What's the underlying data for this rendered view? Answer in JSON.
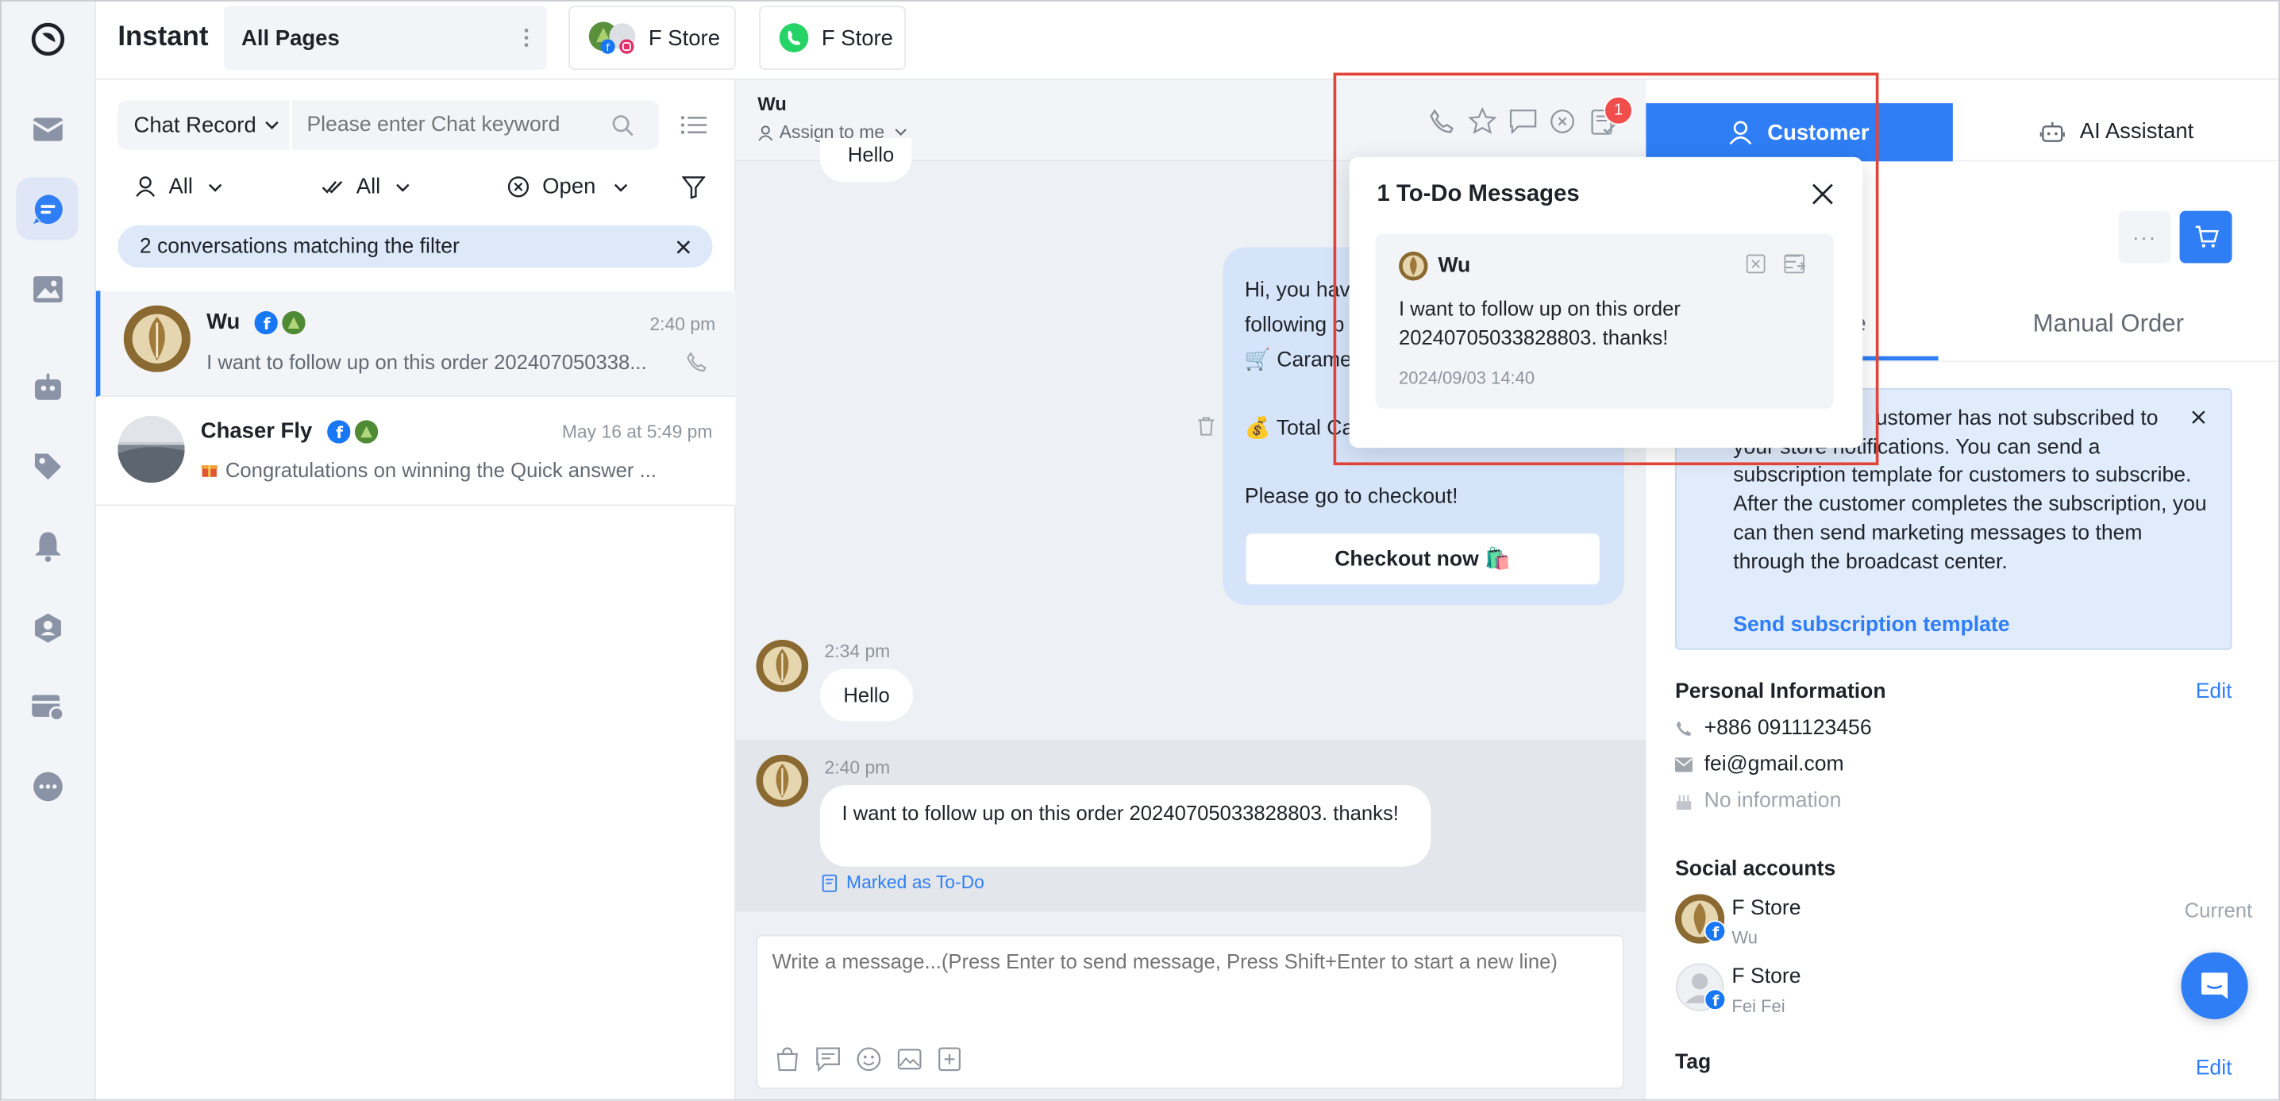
{
  "app": {
    "title": "Instant",
    "pages_label": "All Pages"
  },
  "top_tabs": [
    {
      "label": "F Store",
      "icon": "facebook-instagram-icon"
    },
    {
      "label": "F Store",
      "icon": "whatsapp-icon"
    }
  ],
  "filters": {
    "search_type": "Chat Record",
    "search_placeholder": "Please enter Chat keyword",
    "agent": "All",
    "read": "All",
    "status": "Open",
    "match_text": "2 conversations matching the filter"
  },
  "conversations": [
    {
      "name": "Wu",
      "time": "2:40 pm",
      "preview": "I want to follow up on this order 202407050338..."
    },
    {
      "name": "Chaser Fly",
      "time": "May 16 at 5:49 pm",
      "preview": "Congratulations on winning the Quick answer   ..."
    }
  ],
  "chat": {
    "contact": "Wu",
    "assign": "Assign to me",
    "partial_top_bubble": "Hello",
    "card_lines": [
      "Hi, you hav",
      "following p",
      "🛒 Caramel",
      "💰 Total Ca"
    ],
    "card_footer": "Please go to checkout!",
    "checkout_button": "Checkout now 🛍️",
    "msg1_time": "2:34 pm",
    "msg1_text": "Hello",
    "msg2_time": "2:40 pm",
    "msg2_text": "I want to follow up on this order 20240705033828803. thanks!",
    "todo_mark": "Marked as To-Do",
    "composer_placeholder": "Write a message...(Press Enter to send message, Press Shift+Enter to start a new line)",
    "todo_badge": "1"
  },
  "popup": {
    "title": "1 To-Do Messages",
    "name": "Wu",
    "text": "I want to follow up on this order 20240705033828803. thanks!",
    "time": "2024/09/03 14:40"
  },
  "right": {
    "tab_customer": "Customer",
    "tab_ai": "AI Assistant",
    "tab_manual_order": "Manual Order",
    "tab_partial": "e",
    "notice_partial_line1": "ustomer has not subscribed to",
    "notice_partial_line2": "your store notifications. You can send a",
    "notice_rest": "subscription template for customers to subscribe. After the customer completes the subscription, you can then send marketing messages to them through the broadcast center.",
    "notice_link": "Send subscription template",
    "personal_info": "Personal Information",
    "edit": "Edit",
    "phone": "+886 0911123456",
    "email": "fei@gmail.com",
    "birthday": "No information",
    "social_accounts": "Social accounts",
    "accounts": [
      {
        "store": "F Store",
        "user": "Wu",
        "status": "Current"
      },
      {
        "store": "F Store",
        "user": "Fei Fei",
        "status": ""
      }
    ],
    "tag": "Tag",
    "tag_edit": "Edit"
  },
  "colors": {
    "accent": "#2f7ef5",
    "badge": "#f04d4d",
    "highlight": "#e0453a",
    "sidebar_bg": "#f2f4f7",
    "chat_bg": "#edf0f4"
  }
}
